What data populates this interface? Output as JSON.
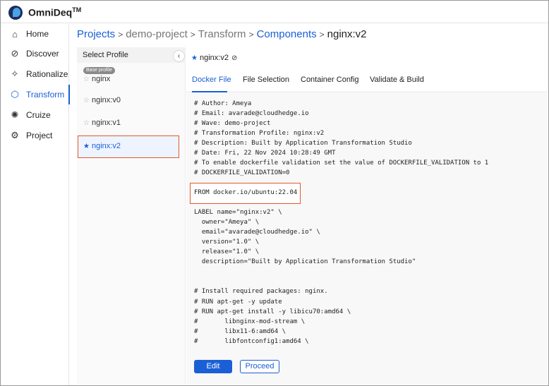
{
  "app": {
    "name": "OmniDeq",
    "trademark": "TM",
    "logo_icon": "omnideq-logo-icon"
  },
  "sidebar": {
    "items": [
      {
        "label": "Home",
        "icon": "home-icon",
        "glyph": "⌂"
      },
      {
        "label": "Discover",
        "icon": "discover-icon",
        "glyph": "⊘"
      },
      {
        "label": "Rationalize",
        "icon": "rationalize-icon",
        "glyph": "✧"
      },
      {
        "label": "Transform",
        "icon": "transform-icon",
        "glyph": "⬡",
        "active": true
      },
      {
        "label": "Cruize",
        "icon": "cruize-icon",
        "glyph": "✺"
      },
      {
        "label": "Project",
        "icon": "project-icon",
        "glyph": "⚙"
      }
    ]
  },
  "breadcrumb": {
    "items": [
      "Projects",
      "demo-project",
      "Transform",
      "Components",
      "nginx:v2"
    ],
    "separator": ">"
  },
  "profiles": {
    "title": "Select Profile",
    "collapse_glyph": "‹",
    "base_badge": "Base profile",
    "items": [
      {
        "name": "nginx",
        "star": "☆"
      },
      {
        "name": "nginx:v0",
        "star": "☆"
      },
      {
        "name": "nginx:v1",
        "star": "☆"
      },
      {
        "name": "nginx:v2",
        "star": "★",
        "selected": true
      }
    ]
  },
  "component": {
    "star": "★",
    "title": "nginx:v2",
    "edit_icon": "⊘"
  },
  "tabs": [
    {
      "label": "Docker File",
      "active": true
    },
    {
      "label": "File Selection"
    },
    {
      "label": "Container Config"
    },
    {
      "label": "Validate & Build"
    }
  ],
  "dockerfile": {
    "header_lines": [
      "# Author: Ameya",
      "# Email: avarade@cloudhedge.io",
      "# Wave: demo-project",
      "# Transformation Profile: nginx:v2",
      "# Description: Built by Application Transformation Studio",
      "# Date: Fri, 22 Nov 2024 10:28:49 GMT",
      "# To enable dockerfile validation set the value of DOCKERFILE_VALIDATION to 1",
      "# DOCKERFILE_VALIDATION=0"
    ],
    "from_line": "FROM docker.io/ubuntu:22.04",
    "label_lines": [
      "LABEL name=\"nginx:v2\" \\",
      "  owner=\"Ameya\" \\",
      "  email=\"avarade@cloudhedge.io\" \\",
      "  version=\"1.0\" \\",
      "  release=\"1.0\" \\",
      "  description=\"Built by Application Transformation Studio\""
    ],
    "install_lines": [
      "# Install required packages: nginx.",
      "# RUN apt-get -y update",
      "# RUN apt-get install -y libicu70:amd64 \\",
      "#       libnginx-mod-stream \\",
      "#       libx11-6:amd64 \\",
      "#       libfontconfig1:amd64 \\"
    ]
  },
  "actions": {
    "edit_label": "Edit",
    "proceed_label": "Proceed"
  },
  "colors": {
    "accent": "#1a5fd6",
    "highlight_border": "#e05a2b"
  }
}
